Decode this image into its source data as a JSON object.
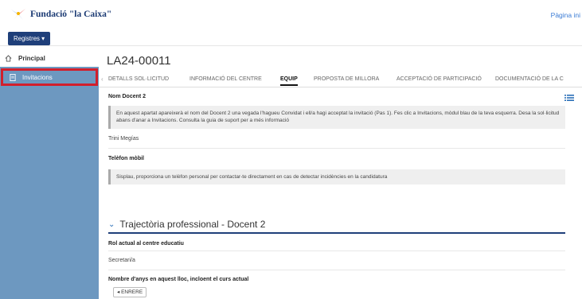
{
  "header": {
    "logo_text": "Fundació \"la Caixa\"",
    "top_link": "Pàgina ini"
  },
  "toolbar": {
    "registres_label": "Registres ▾"
  },
  "sidebar": {
    "items": [
      {
        "label": "Principal",
        "icon": "home-icon"
      },
      {
        "label": "Invitacions",
        "icon": "document-icon"
      }
    ]
  },
  "main": {
    "reference": "LA24-00011",
    "tabs": [
      "DETALLS SOL·LICITUD",
      "INFORMACIÓ DEL CENTRE",
      "EQUIP",
      "PROPOSTA DE MILLORA",
      "ACCEPTACIÓ DE PARTICIPACIÓ",
      "DOCUMENTACIÓ DE LA C"
    ],
    "active_tab": "EQUIP",
    "docent_label": "Nom Docent 2",
    "docent_info": "En aquest apartat apareixerà el nom del Docent 2 una vegada l'hagueu Convidat i ell/a hagi acceptat la invitació (Pas 1). Fes clic a Invitacions, mòdul blau de la teva esquerra. Desa la sol·licitud abans d'anar a Invitacions. Consulta la guia de suport per a més informació",
    "docent_value": "Trini Megías",
    "phone_label": "Telèfon mòbil",
    "phone_info": "Sisplau, proporciona un telèfon personal per contactar-te directament en cas de detectar incidències en la candidatura",
    "section_title": "Trajectòria professional - Docent 2",
    "rol_label": "Rol actual al centre educatiu",
    "rol_value": "Secretari/a",
    "anys_label": "Nombre d'anys en aquest lloc, incloent el curs actual",
    "back_button": "◂ ENRERE"
  },
  "colors": {
    "sidebar_blue": "#6d98c0",
    "brand_navy": "#1f3f7a",
    "highlight_red": "#d21f2c"
  }
}
